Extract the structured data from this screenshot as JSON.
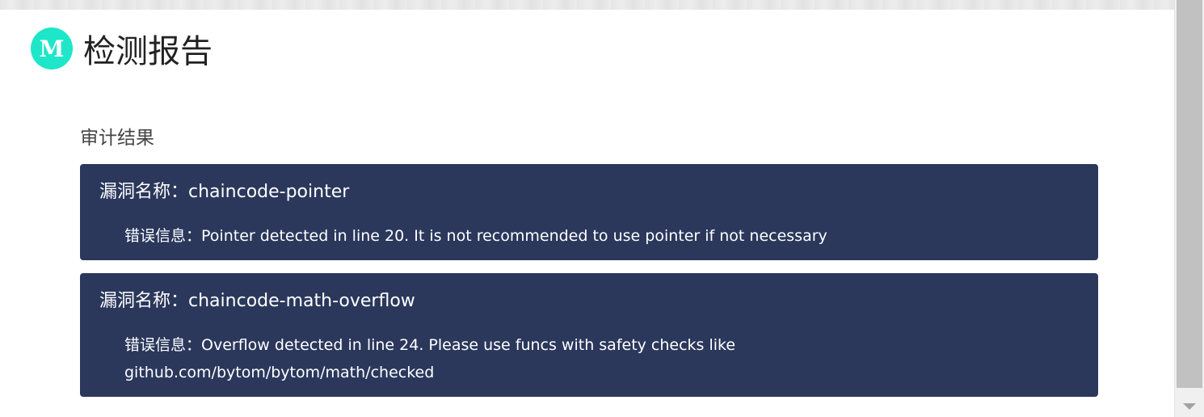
{
  "header": {
    "logo_letter": "M",
    "title": "检测报告"
  },
  "section": {
    "title": "审计结果"
  },
  "findings": [
    {
      "name_label": "漏洞名称：",
      "name": "chaincode-pointer",
      "message_label": "错误信息：",
      "message": "Pointer detected in line 20. It is not recommended to use pointer if not necessary"
    },
    {
      "name_label": "漏洞名称：",
      "name": "chaincode-math-overflow",
      "message_label": "错误信息：",
      "message": "Overflow detected in line 24. Please use funcs with safety checks like github.com/bytom/bytom/math/checked"
    }
  ],
  "colors": {
    "card_background": "#2b385c",
    "logo_background": "#1de7c8"
  }
}
